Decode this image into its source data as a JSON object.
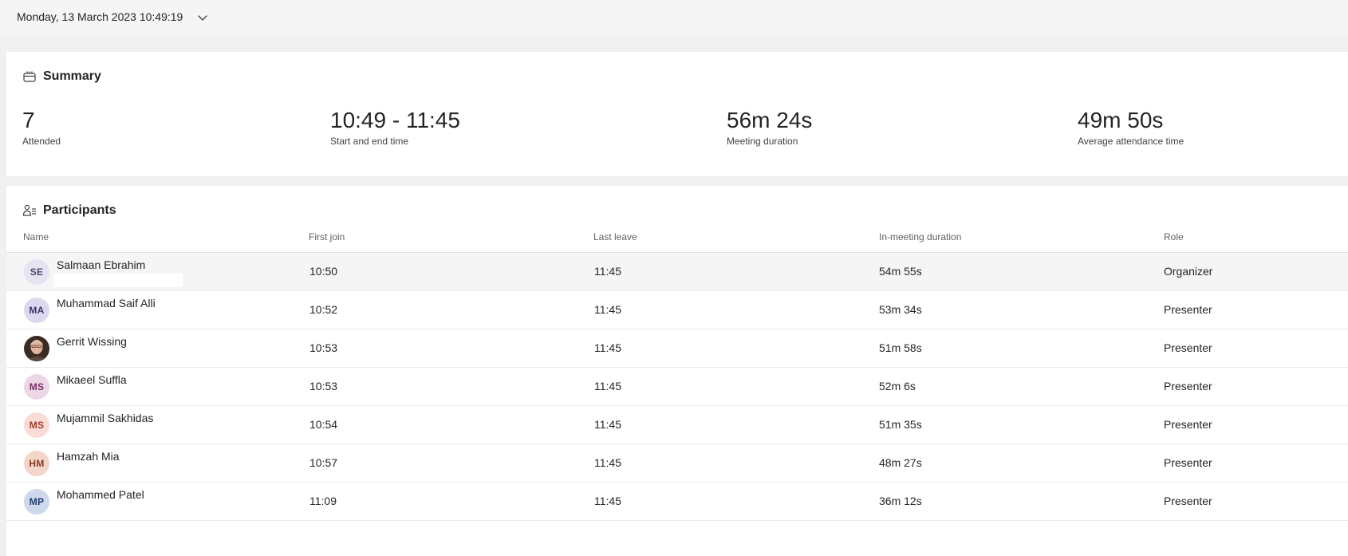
{
  "header": {
    "date_time": "Monday, 13 March 2023 10:49:19"
  },
  "summary": {
    "title": "Summary",
    "stats": [
      {
        "value": "7",
        "label": "Attended"
      },
      {
        "value": "10:49 - 11:45",
        "label": "Start and end time"
      },
      {
        "value": "56m 24s",
        "label": "Meeting duration"
      },
      {
        "value": "49m 50s",
        "label": "Average attendance time"
      }
    ]
  },
  "participants": {
    "title": "Participants",
    "columns": [
      "Name",
      "First join",
      "Last leave",
      "In-meeting duration",
      "Role"
    ],
    "rows": [
      {
        "initials": "SE",
        "name": "Salmaan Ebrahim",
        "first_join": "10:50",
        "last_leave": "11:45",
        "duration": "54m 55s",
        "role": "Organizer",
        "avatar_bg": "#e6e3f2",
        "avatar_fg": "#4f4a6e"
      },
      {
        "initials": "MA",
        "name": "Muhammad Saif Alli",
        "first_join": "10:52",
        "last_leave": "11:45",
        "duration": "53m 34s",
        "role": "Presenter",
        "avatar_bg": "#dcd8ee",
        "avatar_fg": "#3b3570"
      },
      {
        "initials": "",
        "name": "Gerrit Wissing",
        "first_join": "10:53",
        "last_leave": "11:45",
        "duration": "51m 58s",
        "role": "Presenter",
        "avatar_bg": "#7a5a4a",
        "avatar_fg": "#ffffff"
      },
      {
        "initials": "MS",
        "name": "Mikaeel Suffla",
        "first_join": "10:53",
        "last_leave": "11:45",
        "duration": "52m 6s",
        "role": "Presenter",
        "avatar_bg": "#ecd7e6",
        "avatar_fg": "#7a2e63"
      },
      {
        "initials": "MS",
        "name": "Mujammil Sakhidas",
        "first_join": "10:54",
        "last_leave": "11:45",
        "duration": "51m 35s",
        "role": "Presenter",
        "avatar_bg": "#fadcd6",
        "avatar_fg": "#a33b2c"
      },
      {
        "initials": "HM",
        "name": "Hamzah Mia",
        "first_join": "10:57",
        "last_leave": "11:45",
        "duration": "48m 27s",
        "role": "Presenter",
        "avatar_bg": "#f3d6cb",
        "avatar_fg": "#8a3a22"
      },
      {
        "initials": "MP",
        "name": "Mohammed Patel",
        "first_join": "11:09",
        "last_leave": "11:45",
        "duration": "36m 12s",
        "role": "Presenter",
        "avatar_bg": "#cdd8ec",
        "avatar_fg": "#1f3c6e"
      }
    ]
  }
}
